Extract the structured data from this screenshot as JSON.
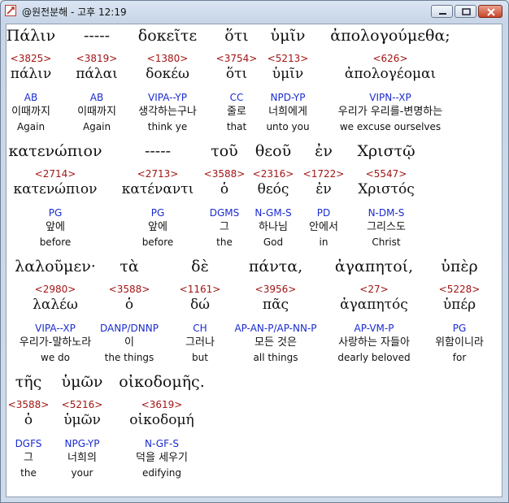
{
  "window": {
    "title": "@원전분해 - 고후 12:19"
  },
  "rows": [
    {
      "words": [
        {
          "greek": "Πάλιν",
          "strong": "<3825>",
          "lexeme": "πάλιν",
          "parse": "AB",
          "korean": "이때까지",
          "english": "Again"
        },
        {
          "greek": "-----",
          "strong": "<3819>",
          "lexeme": "πάλαι",
          "parse": "AB",
          "korean": "이때까지",
          "english": "Again"
        },
        {
          "greek": "δοκεῖτε",
          "strong": "<1380>",
          "lexeme": "δοκέω",
          "parse": "VIPA--YP",
          "korean": "생각하는구나",
          "english": "think ye"
        },
        {
          "greek": "ὅτι",
          "strong": "<3754>",
          "lexeme": "ὅτι",
          "parse": "CC",
          "korean": "줄로",
          "english": "that"
        },
        {
          "greek": "ὑμῖν",
          "strong": "<5213>",
          "lexeme": "ὑμῖν",
          "parse": "NPD-YP",
          "korean": "너희에게",
          "english": "unto you"
        },
        {
          "greek": "ἀπολογούμεθα;",
          "strong": "<626>",
          "lexeme": "ἀπολογέομαι",
          "parse": "VIPN--XP",
          "korean": "우리가 우리를-변명하는",
          "english": "we excuse ourselves"
        }
      ]
    },
    {
      "words": [
        {
          "greek": "κατενώπιον",
          "strong": "<2714>",
          "lexeme": "κατενώπιον",
          "parse": "PG",
          "korean": "앞에",
          "english": "before"
        },
        {
          "greek": "-----",
          "strong": "<2713>",
          "lexeme": "κατέναντι",
          "parse": "PG",
          "korean": "앞에",
          "english": "before"
        },
        {
          "greek": "τοῦ",
          "strong": "<3588>",
          "lexeme": "ὁ",
          "parse": "DGMS",
          "korean": "그",
          "english": "the"
        },
        {
          "greek": "θεοῦ",
          "strong": "<2316>",
          "lexeme": "θεός",
          "parse": "N-GM-S",
          "korean": "하나님",
          "english": "God"
        },
        {
          "greek": "ἐν",
          "strong": "<1722>",
          "lexeme": "ἐν",
          "parse": "PD",
          "korean": "안에서",
          "english": "in"
        },
        {
          "greek": "Χριστῷ",
          "strong": "<5547>",
          "lexeme": "Χριστός",
          "parse": "N-DM-S",
          "korean": "그리스도",
          "english": "Christ"
        }
      ]
    },
    {
      "words": [
        {
          "greek": "λαλοῦμεν·",
          "strong": "<2980>",
          "lexeme": "λαλέω",
          "parse": "VIPA--XP",
          "korean": "우리가-말하노라",
          "english": "we do"
        },
        {
          "greek": "τὰ",
          "strong": "<3588>",
          "lexeme": "ὁ",
          "parse": "DANP/DNNP",
          "korean": "이",
          "english": "the things"
        },
        {
          "greek": "δὲ",
          "strong": "<1161>",
          "lexeme": "δώ",
          "parse": "CH",
          "korean": "그러나",
          "english": "but"
        },
        {
          "greek": "πάντα,",
          "strong": "<3956>",
          "lexeme": "πᾶς",
          "parse": "AP-AN-P/AP-NN-P",
          "korean": "모든 것은",
          "english": "all things"
        },
        {
          "greek": "ἀγαπητοί,",
          "strong": "<27>",
          "lexeme": "ἀγαπητός",
          "parse": "AP-VM-P",
          "korean": "사랑하는 자들아",
          "english": "dearly beloved"
        },
        {
          "greek": "ὑπὲρ",
          "strong": "<5228>",
          "lexeme": "ὑπέρ",
          "parse": "PG",
          "korean": "위함이니라",
          "english": "for"
        }
      ]
    },
    {
      "words": [
        {
          "greek": "τῆς",
          "strong": "<3588>",
          "lexeme": "ὁ",
          "parse": "DGFS",
          "korean": "그",
          "english": "the"
        },
        {
          "greek": "ὑμῶν",
          "strong": "<5216>",
          "lexeme": "ὑμῶν",
          "parse": "NPG-YP",
          "korean": "너희의",
          "english": "your"
        },
        {
          "greek": "οἰκοδομῆς.",
          "strong": "<3619>",
          "lexeme": "οἰκοδομή",
          "parse": "N-GF-S",
          "korean": "덕을 세우기",
          "english": "edifying"
        }
      ]
    }
  ]
}
